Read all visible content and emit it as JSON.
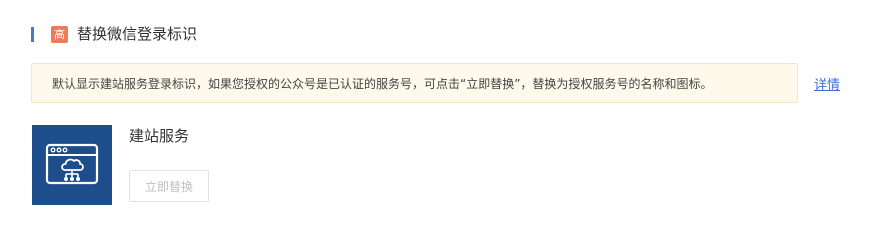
{
  "header": {
    "badge": "高",
    "title": "替换微信登录标识"
  },
  "notice": {
    "text": "默认显示建站服务登录标识，如果您授权的公众号是已认证的服务号，可点击“立即替换”，替换为授权服务号的名称和图标。",
    "link_label": "详情"
  },
  "service": {
    "name": "建站服务",
    "icon": "browser-cloud-network-icon",
    "replace_label": "立即替换",
    "replace_enabled": false
  },
  "colors": {
    "accent": "#4e76c9",
    "badge": "#ed7b5a",
    "logo_bg": "#1e4d8c",
    "link": "#3d6fd6",
    "notice_bg": "#fdf9eb"
  }
}
